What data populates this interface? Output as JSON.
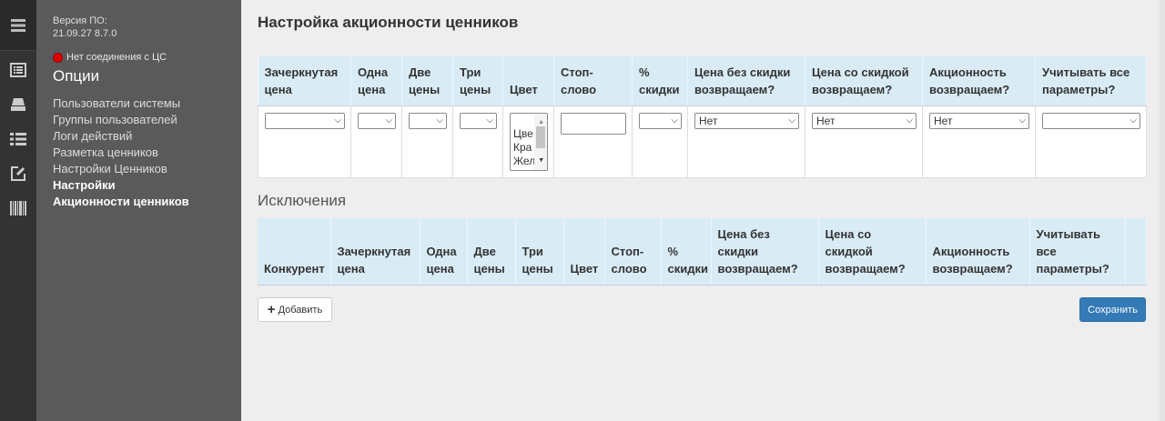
{
  "sidebar": {
    "version_label": "Версия ПО:",
    "version_value": "21.09.27 8.7.0",
    "connection_status": "Нет соединения с ЦС",
    "options_title": "Опции",
    "items": [
      {
        "label": "Пользователи системы"
      },
      {
        "label": "Группы пользователей"
      },
      {
        "label": "Логи действий"
      },
      {
        "label": "Разметка ценников"
      },
      {
        "label": "Настройки Ценников"
      },
      {
        "label": "Настройки Акционности ценников"
      }
    ]
  },
  "rail_icons": [
    "menu-icon",
    "document-list-icon",
    "printer-icon",
    "list-icon",
    "edit-icon",
    "barcode-icon"
  ],
  "main": {
    "title": "Настройка акционности ценников",
    "settings_table": {
      "headers": [
        "Зачеркнутая цена",
        "Одна цена",
        "Две цены",
        "Три цены",
        "Цвет",
        "Стоп-слово",
        "% скидки",
        "Цена без скидки возвращаем?",
        "Цена со скидкой возвращаем?",
        "Акционность возвращаем?",
        "Учитывать все параметры?"
      ],
      "values": {
        "crossed_price": "",
        "one_price": "",
        "two_prices": "",
        "three_prices": "",
        "color_options": [
          "Цве",
          "Кра",
          "Жел"
        ],
        "stop_word": "",
        "discount_percent": "",
        "price_without_discount": "Нет",
        "price_with_discount": "Нет",
        "promo_return": "Нет",
        "all_params": ""
      }
    },
    "exclusions_title": "Исключения",
    "exclusions_table": {
      "headers": [
        "Конкурент",
        "Зачеркнутая цена",
        "Одна цена",
        "Две цены",
        "Три цены",
        "Цвет",
        "Стоп-слово",
        "% скидки",
        "Цена без скидки возвращаем?",
        "Цена со скидкой возвращаем?",
        "Акционность возвращаем?",
        "Учитывать все параметры?"
      ]
    },
    "add_button": "Добавить",
    "save_button": "Сохранить"
  },
  "colors": {
    "header_bg": "#d9ecf6",
    "primary": "#337ab7",
    "status_red": "#e00000"
  }
}
